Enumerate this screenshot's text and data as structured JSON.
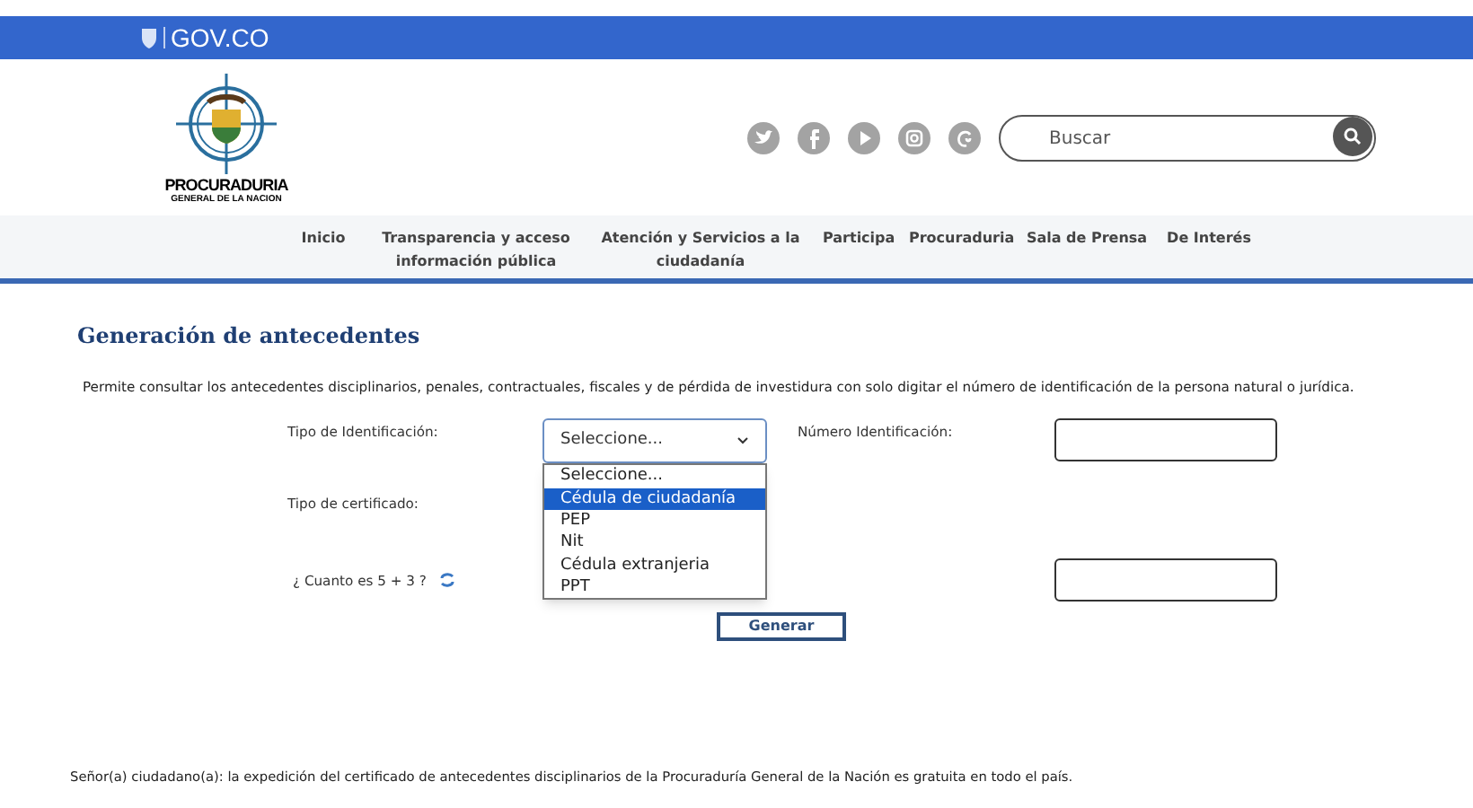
{
  "gov_bar": {
    "brand": "GOV.CO"
  },
  "logo": {
    "line1": "PROCURADURIA",
    "line2": "GENERAL DE LA NACION"
  },
  "search": {
    "placeholder": "Buscar"
  },
  "nav": [
    {
      "label": "Inicio"
    },
    {
      "label": "Transparencia y acceso información pública"
    },
    {
      "label": "Atención y Servicios a la ciudadanía"
    },
    {
      "label": "Participa"
    },
    {
      "label": "Procuraduria"
    },
    {
      "label": "Sala de Prensa"
    },
    {
      "label": "De Interés"
    }
  ],
  "heading": "Generación de antecedentes",
  "description": "Permite consultar los antecedentes disciplinarios, penales, contractuales, fiscales y de pérdida de investidura con solo digitar el número de identificación de la persona natural o jurídica.",
  "form": {
    "id_type": {
      "label": "Tipo de Identificación:",
      "value": "Seleccione...",
      "expanded": true,
      "options": [
        {
          "label": "Seleccione...",
          "highlighted": false
        },
        {
          "label": "Cédula de ciudadanía",
          "highlighted": true
        },
        {
          "label": "PEP",
          "highlighted": false
        },
        {
          "label": "Nit",
          "highlighted": false
        },
        {
          "label": "Cédula extranjeria",
          "highlighted": false
        },
        {
          "label": "PPT",
          "highlighted": false
        }
      ]
    },
    "id_number": {
      "label": "Número Identificación:"
    },
    "certificate_type": {
      "label": "Tipo de certificado:"
    },
    "captcha": {
      "label": "¿ Cuanto es 5 + 3 ?"
    },
    "submit": "Generar"
  },
  "footer_note": "Señor(a) ciudadano(a): la expedición del certificado de antecedentes disciplinarios de la Procuraduría General de la Nación es gratuita en todo el país."
}
